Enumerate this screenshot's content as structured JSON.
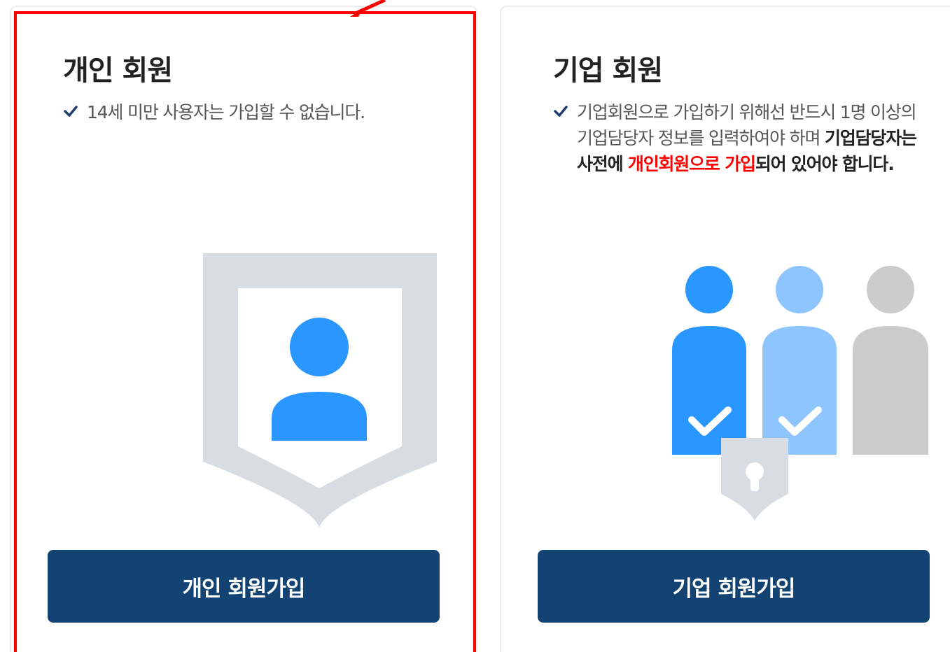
{
  "cards": {
    "personal": {
      "title": "개인 회원",
      "notice": "14세 미만 사용자는 가입할 수 없습니다.",
      "button_label": "개인 회원가입",
      "illustration_icon": "shield-user-icon"
    },
    "corporate": {
      "title": "기업 회원",
      "notice_line1": "기업회원으로 가입하기 위해선 반드시 1명 이상의 기업담당자 정보를 입력하여야 하며",
      "notice_bold_pre": "기업담당자는 사전에 ",
      "notice_red": "개인회원으로 가입",
      "notice_bold_post": "되어 있어야 합니다.",
      "button_label": "기업 회원가입",
      "illustration_icon": "group-users-lock-icon"
    }
  },
  "colors": {
    "button_bg": "#124373",
    "accent_blue": "#2997ff",
    "light_blue": "#8ec5ff",
    "gray_person": "#cccccc",
    "shield_gray": "#d8dde3",
    "highlight_red": "#ff0000"
  }
}
